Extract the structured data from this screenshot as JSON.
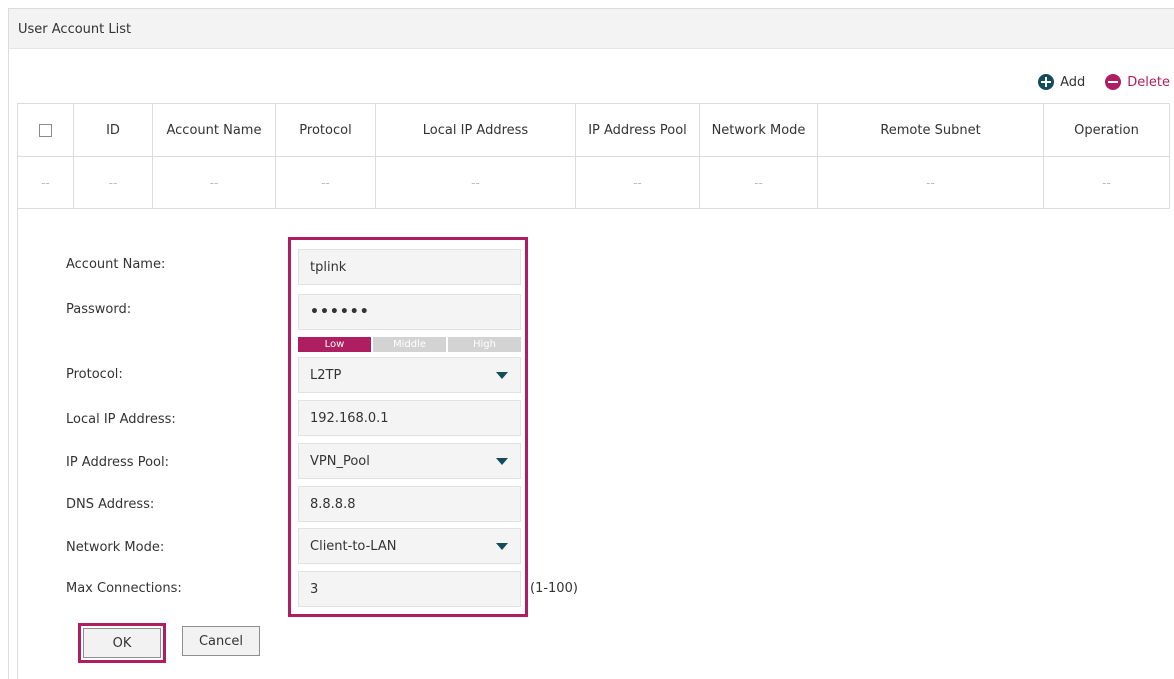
{
  "panel": {
    "title": "User Account List"
  },
  "toolbar": {
    "add_label": "Add",
    "delete_label": "Delete"
  },
  "table": {
    "headers": [
      "ID",
      "Account Name",
      "Protocol",
      "Local IP Address",
      "IP Address Pool",
      "Network Mode",
      "Remote Subnet",
      "Operation"
    ],
    "row": [
      "--",
      "--",
      "--",
      "--",
      "--",
      "--",
      "--",
      "--",
      "--"
    ]
  },
  "form": {
    "account_name": {
      "label": "Account Name:",
      "value": "tplink"
    },
    "password": {
      "label": "Password:",
      "value": "••••••"
    },
    "strength": {
      "low": "Low",
      "middle": "Middle",
      "high": "High",
      "level": "Low"
    },
    "protocol": {
      "label": "Protocol:",
      "value": "L2TP"
    },
    "local_ip": {
      "label": "Local IP Address:",
      "value": "192.168.0.1"
    },
    "ip_pool": {
      "label": "IP Address Pool:",
      "value": "VPN_Pool"
    },
    "dns": {
      "label": "DNS Address:",
      "value": "8.8.8.8"
    },
    "network_mode": {
      "label": "Network Mode:",
      "value": "Client-to-LAN"
    },
    "max_connections": {
      "label": "Max Connections:",
      "value": "3",
      "range": "(1-100)"
    },
    "ok_label": "OK",
    "cancel_label": "Cancel"
  },
  "colors": {
    "accent": "#b01e62",
    "icon_dark": "#134c5a",
    "header_bg": "#f3f3f3"
  },
  "icons": {
    "add": "plus-circle-icon",
    "delete": "minus-circle-icon",
    "dropdown": "caret-down-icon"
  }
}
